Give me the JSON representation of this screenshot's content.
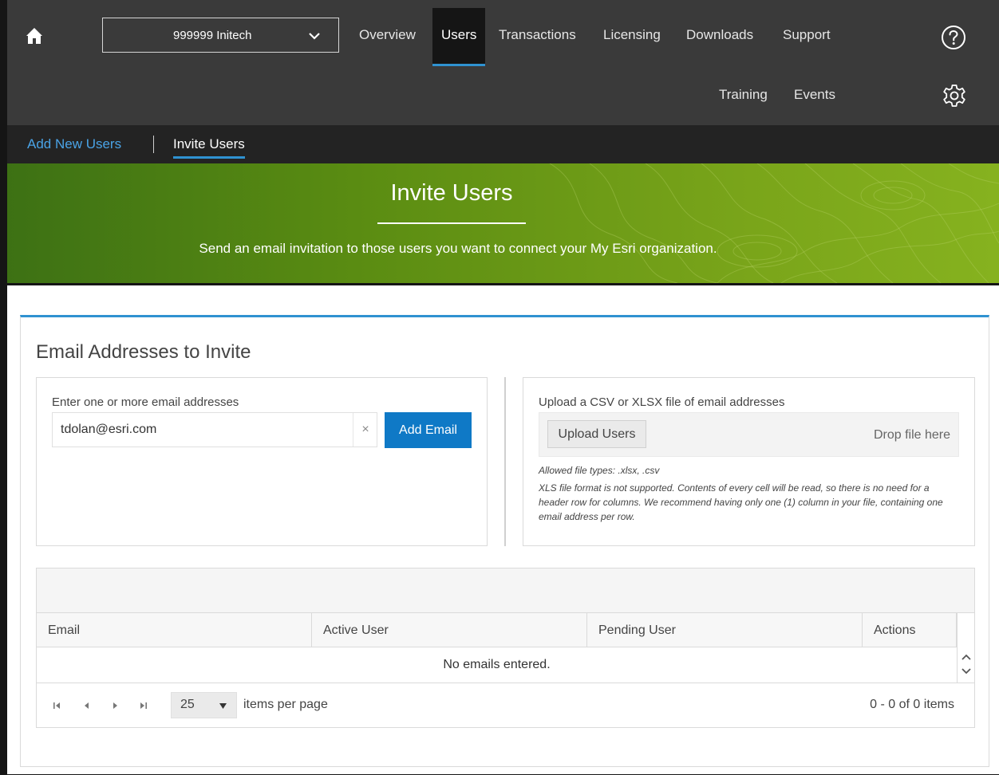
{
  "org": {
    "selected": "999999 Initech"
  },
  "nav": {
    "items": [
      "Overview",
      "Users",
      "Transactions",
      "Licensing",
      "Downloads",
      "Support"
    ],
    "active": "Users",
    "secondary": [
      "Training",
      "Events"
    ]
  },
  "subnav": {
    "add_new": "Add New Users",
    "invite": "Invite Users"
  },
  "banner": {
    "title": "Invite Users",
    "subtitle": "Send an email invitation to those users you want to connect your My Esri organization."
  },
  "section": {
    "title": "Email Addresses to Invite"
  },
  "email_panel": {
    "label": "Enter one or more email addresses",
    "input_value": "tdolan@esri.com",
    "clear_symbol": "×",
    "add_button": "Add Email"
  },
  "upload_panel": {
    "label": "Upload a CSV or XLSX file of email addresses",
    "upload_button": "Upload Users",
    "drop_text": "Drop file here",
    "allowed_types": "Allowed file types: .xlsx, .csv",
    "note": "XLS file format is not supported. Contents of every cell will be read, so there is no need for a header row for columns. We recommend having only one (1) column in your file, containing one email address per row."
  },
  "grid": {
    "columns": [
      "Email",
      "Active User",
      "Pending User",
      "Actions"
    ],
    "empty_message": "No emails entered.",
    "page_size": "25",
    "page_size_label": "items per page",
    "page_info": "0 - 0 of 0 items"
  },
  "colors": {
    "accent": "#2f92d1",
    "primary_button": "#0f79c6",
    "nav_bg": "#3a3a3a"
  }
}
